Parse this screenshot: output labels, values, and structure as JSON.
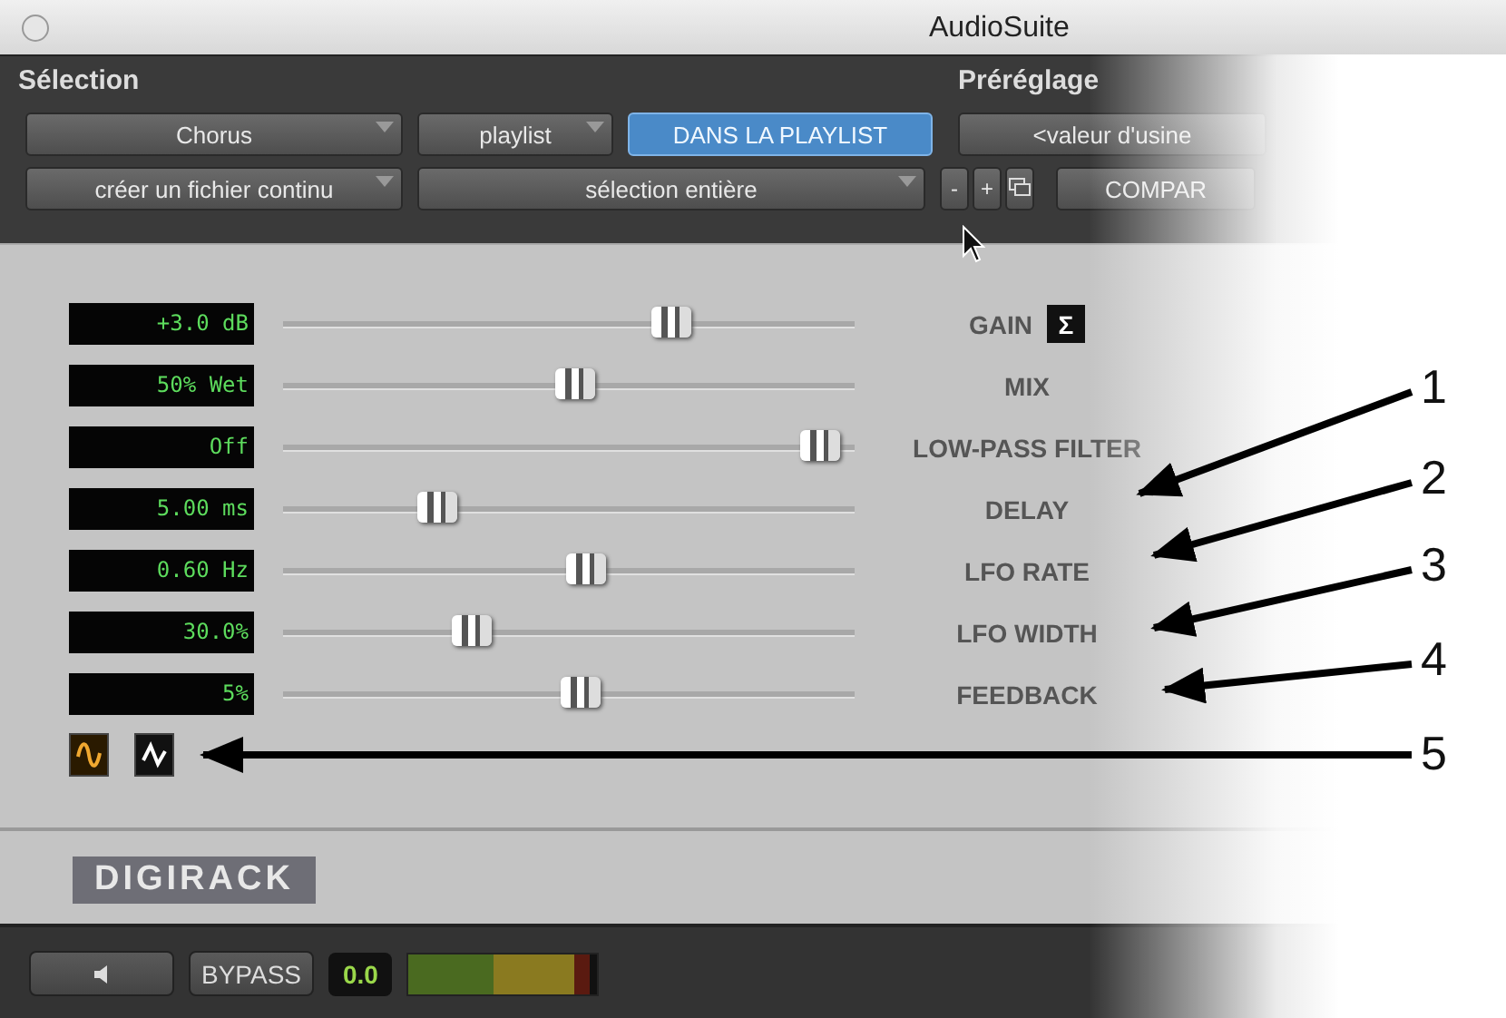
{
  "window": {
    "title": "AudioSuite"
  },
  "sections": [
    {
      "title": "Sélection"
    },
    {
      "title": "Préréglage"
    }
  ],
  "selection_row1": [
    {
      "label": "Chorus",
      "kind": "dropdown",
      "selected": false
    },
    {
      "label": "playlist",
      "kind": "dropdown",
      "selected": false
    },
    {
      "label": "DANS LA PLAYLIST",
      "kind": "toggle",
      "selected": true
    }
  ],
  "selection_row2": [
    {
      "label": "créer un fichier continu",
      "kind": "dropdown"
    },
    {
      "label": "sélection entière",
      "kind": "dropdown"
    }
  ],
  "preset": {
    "value": "<valeur d'usine",
    "minus": "-",
    "plus": "+",
    "compare": "COMPAR"
  },
  "parameters": [
    {
      "reading": "+3.0 dB",
      "name": "GAIN",
      "level": 0.68,
      "button": "Σ"
    },
    {
      "reading": "50% Wet",
      "name": "MIX",
      "level": 0.51
    },
    {
      "reading": "Off",
      "name": "LOW-PASS FILTER",
      "level": 0.94
    },
    {
      "reading": "5.00 ms",
      "name": "DELAY",
      "level": 0.27
    },
    {
      "reading": "0.60 Hz",
      "name": "LFO RATE",
      "level": 0.53
    },
    {
      "reading": "30.0%",
      "name": "LFO WIDTH",
      "level": 0.33
    },
    {
      "reading": "5%",
      "name": "FEEDBACK",
      "level": 0.52
    }
  ],
  "waveforms": [
    {
      "kind": "sine",
      "selected": true
    },
    {
      "kind": "triangle",
      "selected": false
    }
  ],
  "logo": "DIGIRACK",
  "footer": {
    "bypass": "BYPASS",
    "output_reading": "0.0"
  },
  "annotations": [
    {
      "number": "1"
    },
    {
      "number": "2"
    },
    {
      "number": "3"
    },
    {
      "number": "4"
    },
    {
      "number": "5"
    }
  ]
}
